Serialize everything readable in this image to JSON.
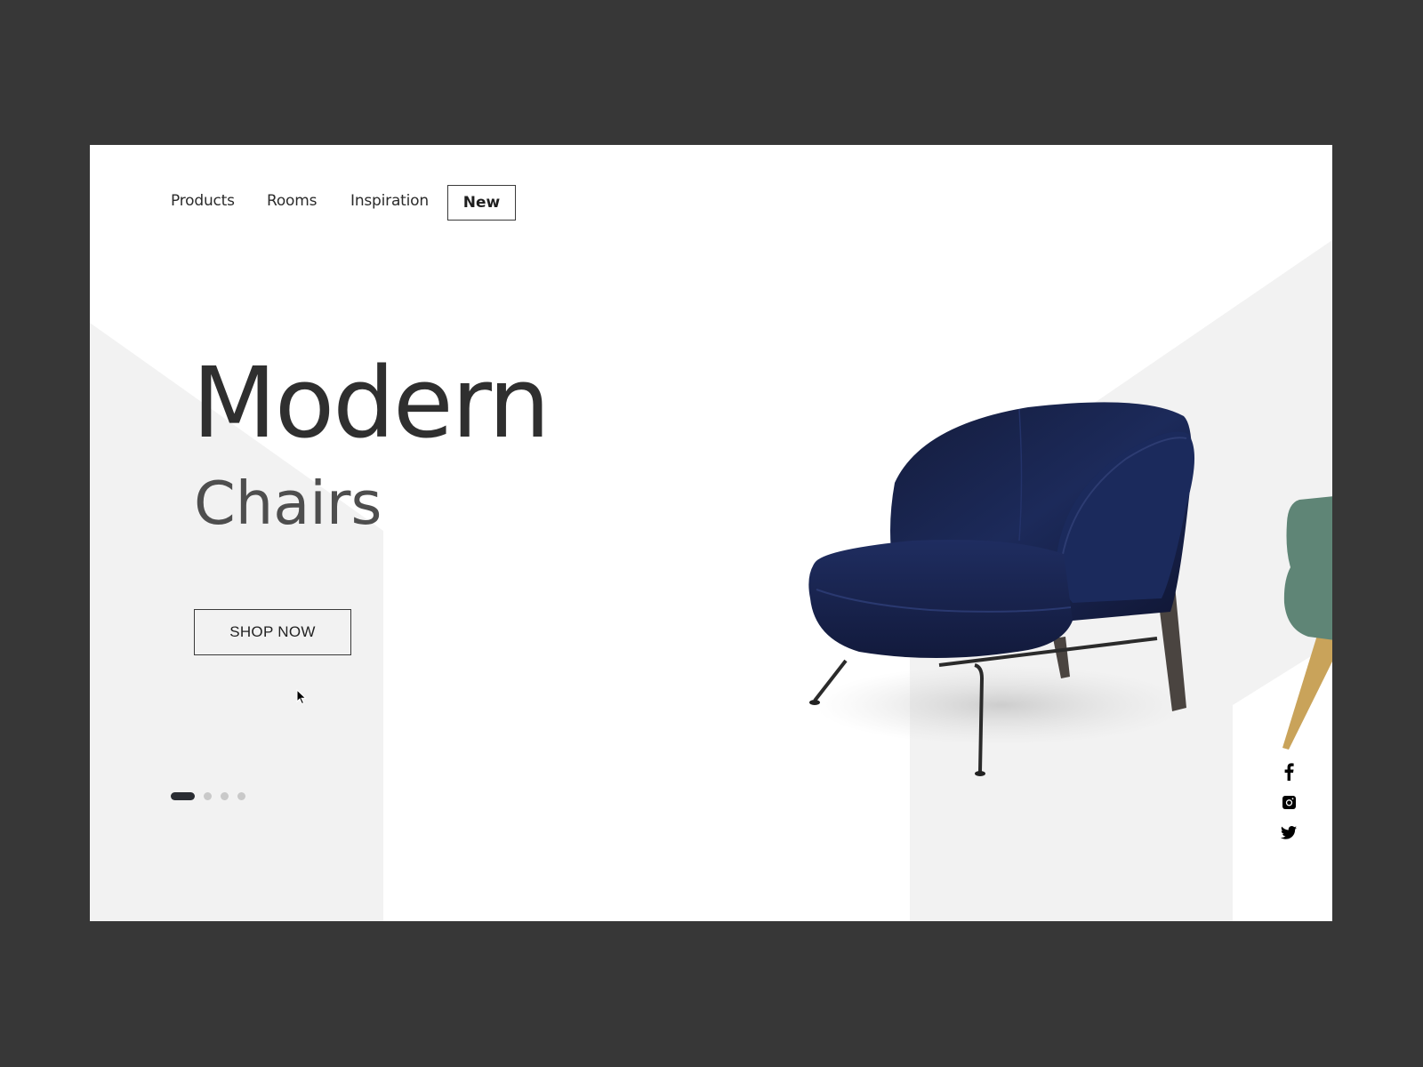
{
  "nav": {
    "items": [
      {
        "label": "Products"
      },
      {
        "label": "Rooms"
      },
      {
        "label": "Inspiration"
      }
    ],
    "new_label": "New"
  },
  "hero": {
    "title": "Modern",
    "subtitle": "Chairs",
    "cta_label": "SHOP NOW"
  },
  "carousel": {
    "total_slides": 4,
    "active_index": 0
  },
  "product": {
    "main_image": "navy-velvet-armchair",
    "next_image": "green-upholstered-chair"
  },
  "social": {
    "icons": [
      "facebook-icon",
      "instagram-icon",
      "twitter-icon"
    ]
  },
  "colors": {
    "page_bg": "#373737",
    "card_bg": "#ffffff",
    "shape_gray": "#f2f2f2",
    "text_dark": "#2f2f2f",
    "chair_navy": "#1a2550",
    "active_dot": "#2a2d33",
    "inactive_dot": "#c9c9c9"
  }
}
